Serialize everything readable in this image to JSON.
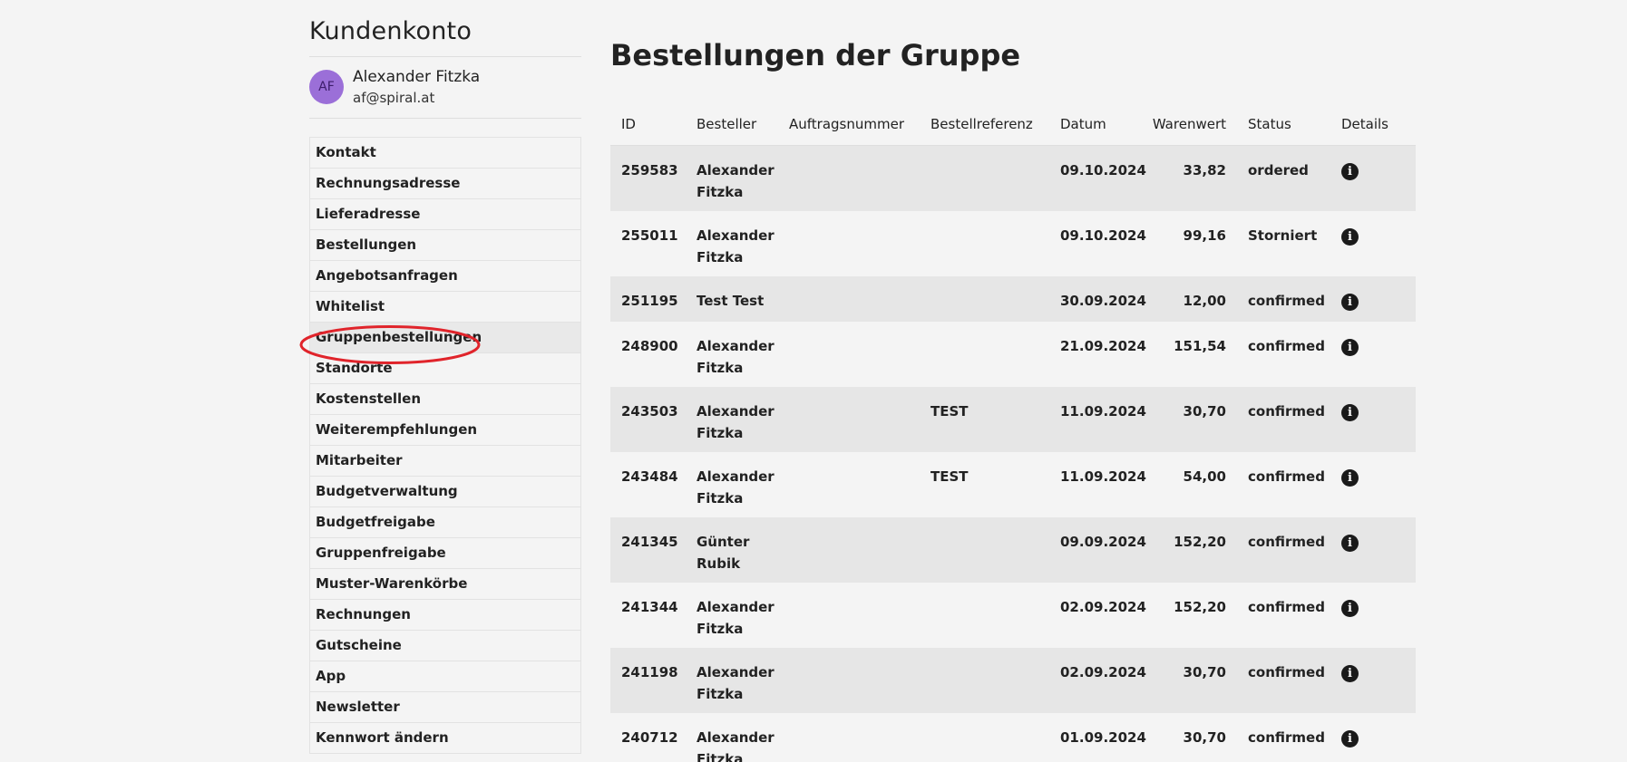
{
  "sidebar": {
    "title": "Kundenkonto",
    "user": {
      "initials": "AF",
      "name": "Alexander Fitzka",
      "email": "af@spiral.at"
    },
    "items": [
      {
        "label": "Kontakt"
      },
      {
        "label": "Rechnungsadresse"
      },
      {
        "label": "Lieferadresse"
      },
      {
        "label": "Bestellungen"
      },
      {
        "label": "Angebotsanfragen"
      },
      {
        "label": "Whitelist"
      },
      {
        "label": "Gruppenbestellungen",
        "active": true
      },
      {
        "label": "Standorte"
      },
      {
        "label": "Kostenstellen"
      },
      {
        "label": "Weiterempfehlungen"
      },
      {
        "label": "Mitarbeiter"
      },
      {
        "label": "Budgetverwaltung"
      },
      {
        "label": "Budgetfreigabe"
      },
      {
        "label": "Gruppenfreigabe"
      },
      {
        "label": "Muster-Warenkörbe"
      },
      {
        "label": "Rechnungen"
      },
      {
        "label": "Gutscheine"
      },
      {
        "label": "App"
      },
      {
        "label": "Newsletter"
      },
      {
        "label": "Kennwort ändern"
      }
    ]
  },
  "main": {
    "title": "Bestellungen der Gruppe",
    "columns": {
      "id": "ID",
      "besteller": "Besteller",
      "auftragsnummer": "Auftragsnummer",
      "bestellreferenz": "Bestellreferenz",
      "datum": "Datum",
      "warenwert": "Warenwert",
      "status": "Status",
      "details": "Details"
    },
    "rows": [
      {
        "id": "259583",
        "besteller_first": "Alexander",
        "besteller_last": "Fitzka",
        "auftragsnummer": "",
        "bestellreferenz": "",
        "datum": "09.10.2024",
        "warenwert": "33,82",
        "status": "ordered"
      },
      {
        "id": "255011",
        "besteller_first": "Alexander",
        "besteller_last": "Fitzka",
        "auftragsnummer": "",
        "bestellreferenz": "",
        "datum": "09.10.2024",
        "warenwert": "99,16",
        "status": "Storniert"
      },
      {
        "id": "251195",
        "besteller_first": "Test Test",
        "besteller_last": "",
        "auftragsnummer": "",
        "bestellreferenz": "",
        "datum": "30.09.2024",
        "warenwert": "12,00",
        "status": "confirmed"
      },
      {
        "id": "248900",
        "besteller_first": "Alexander",
        "besteller_last": "Fitzka",
        "auftragsnummer": "",
        "bestellreferenz": "",
        "datum": "21.09.2024",
        "warenwert": "151,54",
        "status": "confirmed"
      },
      {
        "id": "243503",
        "besteller_first": "Alexander",
        "besteller_last": "Fitzka",
        "auftragsnummer": "",
        "bestellreferenz": "TEST",
        "datum": "11.09.2024",
        "warenwert": "30,70",
        "status": "confirmed"
      },
      {
        "id": "243484",
        "besteller_first": "Alexander",
        "besteller_last": "Fitzka",
        "auftragsnummer": "",
        "bestellreferenz": "TEST",
        "datum": "11.09.2024",
        "warenwert": "54,00",
        "status": "confirmed"
      },
      {
        "id": "241345",
        "besteller_first": "Günter",
        "besteller_last": "Rubik",
        "auftragsnummer": "",
        "bestellreferenz": "",
        "datum": "09.09.2024",
        "warenwert": "152,20",
        "status": "confirmed"
      },
      {
        "id": "241344",
        "besteller_first": "Alexander",
        "besteller_last": "Fitzka",
        "auftragsnummer": "",
        "bestellreferenz": "",
        "datum": "02.09.2024",
        "warenwert": "152,20",
        "status": "confirmed"
      },
      {
        "id": "241198",
        "besteller_first": "Alexander",
        "besteller_last": "Fitzka",
        "auftragsnummer": "",
        "bestellreferenz": "",
        "datum": "02.09.2024",
        "warenwert": "30,70",
        "status": "confirmed"
      },
      {
        "id": "240712",
        "besteller_first": "Alexander",
        "besteller_last": "Fitzka",
        "auftragsnummer": "",
        "bestellreferenz": "",
        "datum": "01.09.2024",
        "warenwert": "30,70",
        "status": "confirmed"
      }
    ],
    "details_icon": "info-icon",
    "details_glyph": "i"
  },
  "annotation": {
    "color": "#e0242b",
    "target": "Gruppenbestellungen"
  }
}
